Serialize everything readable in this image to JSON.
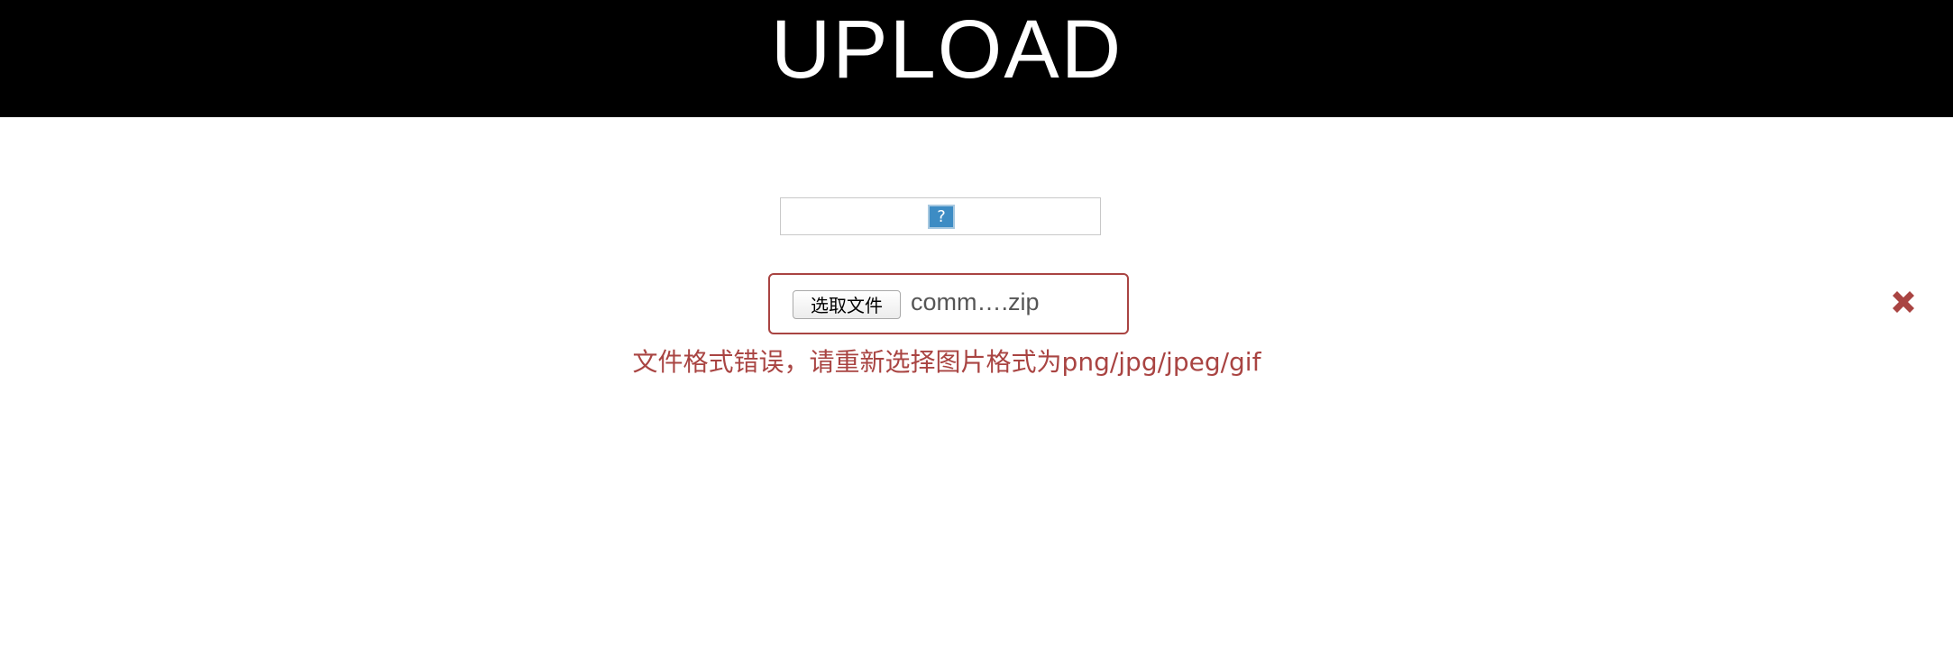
{
  "header": {
    "title": "UPLOAD"
  },
  "preview": {
    "icon": "broken-image-icon",
    "icon_glyph": "?"
  },
  "file_input": {
    "button_label": "选取文件",
    "file_name": "comm….zip"
  },
  "validation": {
    "error_text": "文件格式错误，请重新选择图片格式为png/jpg/jpeg/gif",
    "status_icon": "close-icon"
  },
  "colors": {
    "header_background": "#000000",
    "header_text": "#ffffff",
    "error": "#a94442",
    "icon_blue": "#3d8cc4"
  }
}
